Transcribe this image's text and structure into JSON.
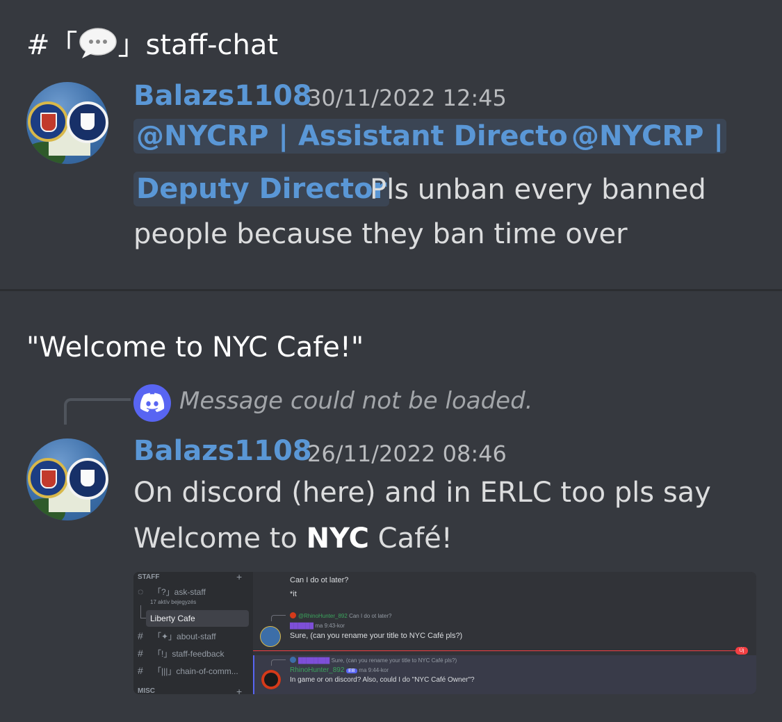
{
  "top": {
    "channel_heading": "#「",
    "channel_heading_end": "」staff-chat",
    "message": {
      "author": "Balazs1108",
      "timestamp": "30/11/2022 12:45",
      "mention1": "@NYCRP | Assistant Director",
      "mention2": "@NYCRP |",
      "mention3": "Deputy Director",
      "text_line1": " Pls unban every banned",
      "text_line2": "people because they ban time over"
    }
  },
  "bottom": {
    "heading": "\"Welcome to NYC Cafe!\"",
    "reply": {
      "text": "Message could not be loaded."
    },
    "message": {
      "author": "Balazs1108",
      "timestamp": "26/11/2022 08:46",
      "text_line1": "On discord (here) and  in ERLC too pls say",
      "text_line2_pre": "Welcome to ",
      "text_line2_bold": "NYC",
      "text_line2_post": " Café!"
    },
    "attachment": {
      "sidebar": {
        "category": "STAFF",
        "items": [
          {
            "label": "「?」ask-staff",
            "sub": "17 aktív bejegyzés"
          },
          {
            "label": "Liberty Cafe"
          },
          {
            "label": "「✦」about-staff"
          },
          {
            "label": "「!」staff-feedback"
          },
          {
            "label": "「|||」chain-of-comm..."
          }
        ],
        "category2": "MISC"
      },
      "chat": {
        "line1": "Can I do ot later?",
        "line2": "*it",
        "reply1_user": "@RhinoHunter_892",
        "reply1_text": "Can I do ot later?",
        "msg1_time": "ma 9:43-kor",
        "msg1_text": "Sure, (can you rename your title to NYC Café pls?)",
        "new_badge": "Új",
        "reply2_text": "Sure, (can you rename your title to NYC Café pls?)",
        "msg2_author": "RhinoHunter_892",
        "msg2_badge": "EB",
        "msg2_time": "ma 9:44-kor",
        "msg2_text": "In game or on discord? Also, could I do \"NYC Café Owner\"?"
      }
    }
  },
  "colors": {
    "background": "#36393f",
    "author": "#5a97d6",
    "mention_bg": "#3b4554",
    "discord_blurple": "#5865f2"
  }
}
